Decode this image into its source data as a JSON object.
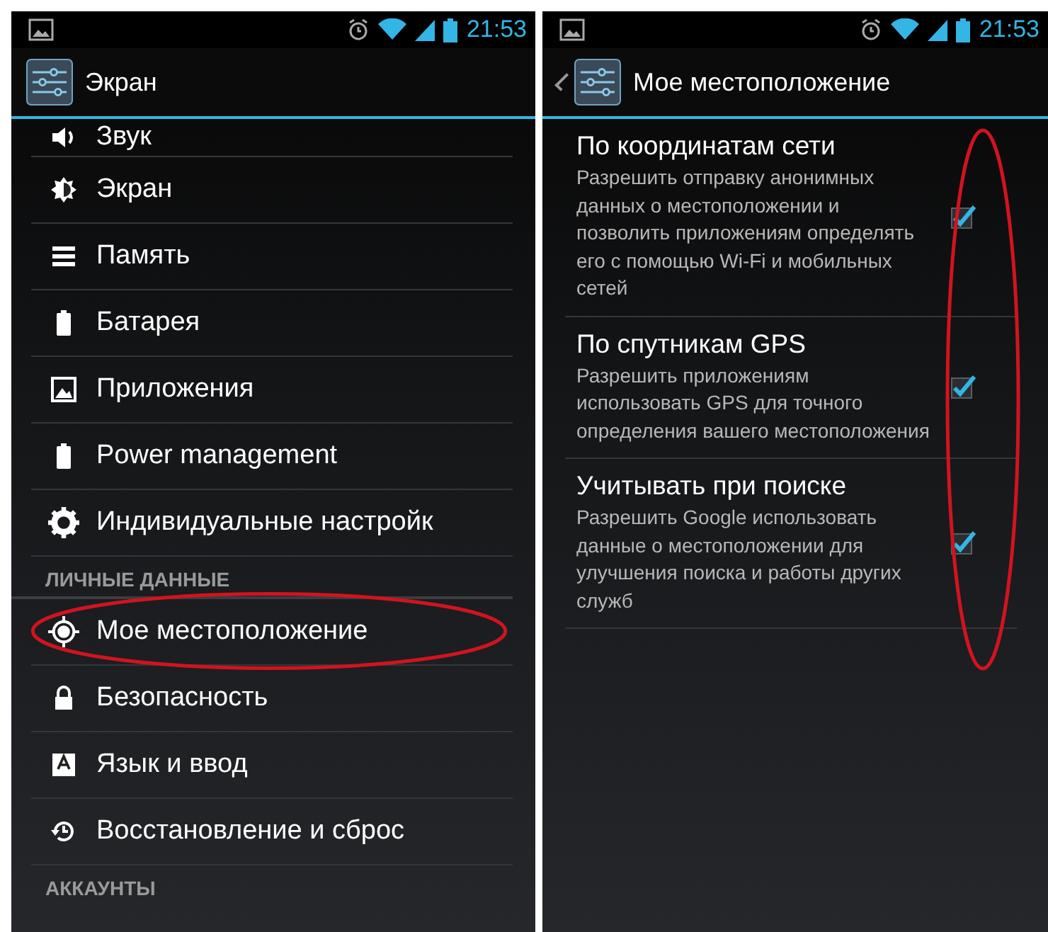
{
  "screens": [
    {
      "status_bar": {
        "time": "21:53"
      },
      "action_bar": {
        "title": "Экран",
        "back": false
      },
      "list": [
        {
          "kind": "item",
          "label": "Звук",
          "circled": false
        },
        {
          "kind": "item",
          "label": "Экран",
          "circled": false
        },
        {
          "kind": "item",
          "label": "Память",
          "circled": false
        },
        {
          "kind": "item",
          "label": "Батарея",
          "circled": false
        },
        {
          "kind": "item",
          "label": "Приложения",
          "circled": false
        },
        {
          "kind": "item",
          "label": "Power management",
          "circled": false
        },
        {
          "kind": "item",
          "label": "Индивидуальные настройк",
          "circled": false
        },
        {
          "kind": "header",
          "label": "ЛИЧНЫЕ ДАННЫЕ"
        },
        {
          "kind": "item",
          "label": "Мое местоположение",
          "circled": true
        },
        {
          "kind": "item",
          "label": "Безопасность",
          "circled": false
        },
        {
          "kind": "item",
          "label": "Язык и ввод",
          "circled": false
        },
        {
          "kind": "item",
          "label": "Восстановление и сброс",
          "circled": false
        },
        {
          "kind": "header",
          "label": "АККАУНТЫ"
        }
      ]
    },
    {
      "status_bar": {
        "time": "21:53"
      },
      "action_bar": {
        "title": "Мое местоположение",
        "back": true
      },
      "checkboxes_circled": true,
      "preferences": [
        {
          "title": "По координатам сети",
          "summary": "Разрешить отправку анонимных данных о местоположении и позволить приложениям определять его с помощью Wi-Fi и мобильных сетей",
          "checked": true
        },
        {
          "title": "По спутникам GPS",
          "summary": "Разрешить приложениям использовать GPS для точного определения вашего местоположения",
          "checked": true
        },
        {
          "title": "Учитывать при поиске",
          "summary": "Разрешить Google использовать данные о местоположении для улучшения поиска и работы других служб",
          "checked": true
        }
      ]
    }
  ]
}
